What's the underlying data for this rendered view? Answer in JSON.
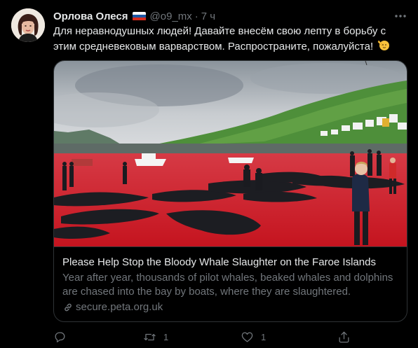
{
  "tweet": {
    "display_name": "Орлова Олеся",
    "handle": "@o9_mx",
    "dot": "·",
    "time": "7 ч",
    "text": "Для неравнодушных людей! Давайте внесём свою лепту в борьбу с этим средневековым варварством. Распространите, пожалуйста!",
    "flag_icon": "russia-flag-icon",
    "emoji": "🫡"
  },
  "card": {
    "title": "Please Help Stop the Bloody Whale Slaughter on the Faroe Islands",
    "description": "Year after year, thousands of pilot whales, beaked whales and dolphins are chased into the bay by boats, where they are slaughtered.",
    "domain": "secure.peta.org.uk"
  },
  "actions": {
    "reply_count": "",
    "retweet_count": "1",
    "like_count": "1"
  },
  "colors": {
    "background": "#000000",
    "text_primary": "#e7e9ea",
    "text_secondary": "#71767b",
    "border": "#2f3336",
    "water_red": "#cf1d2a"
  }
}
